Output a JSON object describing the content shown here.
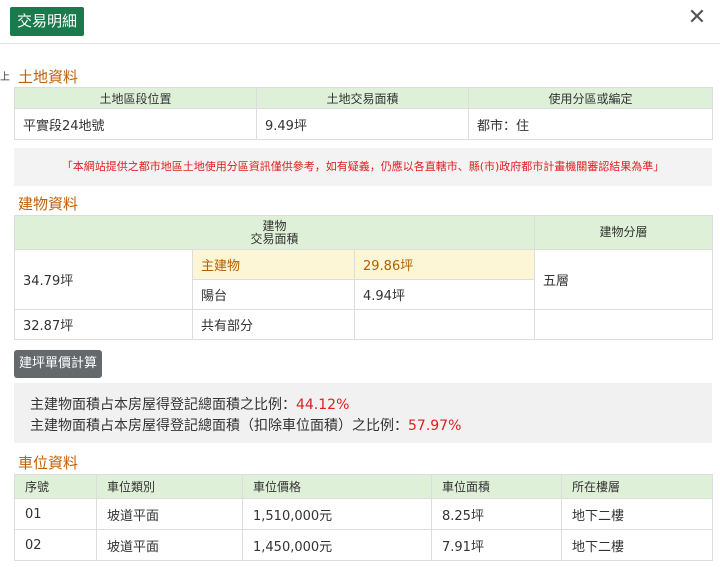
{
  "window": {
    "title": "交易明細",
    "close_label": "✕",
    "left_mark": "上"
  },
  "land": {
    "title": "土地資料",
    "headers": [
      "土地區段位置",
      "土地交易面積",
      "使用分區或編定"
    ],
    "row": [
      "平實段24地號",
      "9.49坪",
      "都市：住"
    ]
  },
  "notice": "「本網站提供之都市地區土地使用分區資訊僅供參考，如有疑義，仍應以各直轄市、縣(市)政府都市計畫機關審認結果為準」",
  "building": {
    "title": "建物資料",
    "header_area_line1": "建物",
    "header_area_line2": "交易面積",
    "header_floor": "建物分層",
    "total_area": "34.79坪",
    "main_label": "主建物",
    "main_value": "29.86坪",
    "balcony_label": "陽台",
    "balcony_value": "4.94坪",
    "floor": "五層",
    "shared_value": "32.87坪",
    "shared_label": "共有部分"
  },
  "calc_button": "建坪單價計算",
  "ratios": {
    "line1_label": "主建物面積占本房屋得登記總面積之比例：",
    "line1_value": "44.12%",
    "line2_label": "主建物面積占本房屋得登記總面積（扣除車位面積）之比例：",
    "line2_value": "57.97%"
  },
  "parking": {
    "title": "車位資料",
    "headers": [
      "序號",
      "車位類別",
      "車位價格",
      "車位面積",
      "所在樓層"
    ],
    "rows": [
      [
        "01",
        "坡道平面",
        "1,510,000元",
        "8.25坪",
        "地下二樓"
      ],
      [
        "02",
        "坡道平面",
        "1,450,000元",
        "7.91坪",
        "地下二樓"
      ]
    ]
  },
  "colors": {
    "accent": "#1a7a4c",
    "section_title": "#c0610a",
    "header_bg": "#dff0d8",
    "highlight": "#e02020"
  }
}
